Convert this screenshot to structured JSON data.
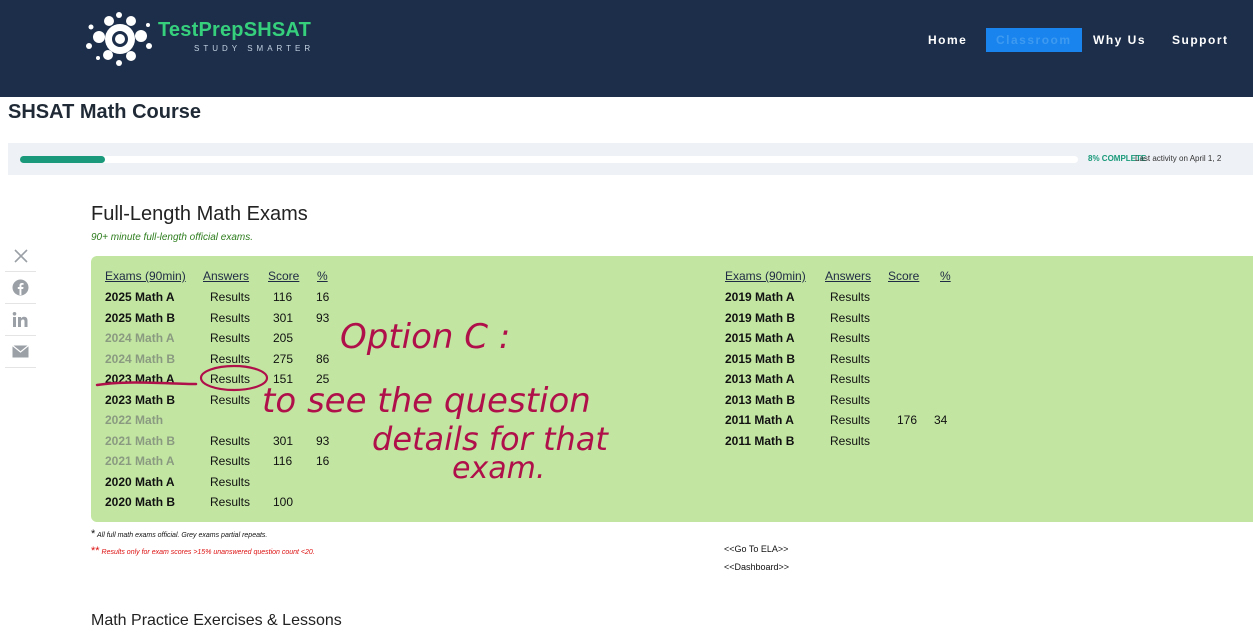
{
  "header": {
    "brand_name": "TestPrepSHSAT",
    "tagline": "STUDY SMARTER",
    "nav": {
      "home": "Home",
      "classroom": "Classroom",
      "why_us": "Why Us",
      "support": "Support"
    }
  },
  "page": {
    "title": "SHSAT Math Course"
  },
  "progress": {
    "percent": 8,
    "complete_label": "8% COMPLETE",
    "last_activity": "Last activity on April 1, 2"
  },
  "share": {
    "icons": [
      "x-icon",
      "facebook-icon",
      "linkedin-icon",
      "email-icon"
    ]
  },
  "exams": {
    "title": "Full-Length Math Exams",
    "subtitle": "90+ minute full-length official exams.",
    "headers": {
      "exam": "Exams (90min)",
      "answers": "Answers",
      "score": "Score",
      "pct": "%"
    },
    "left": [
      {
        "name": "2025 Math A",
        "answers": "Results",
        "score": "116",
        "pct": "16",
        "grey": false
      },
      {
        "name": "2025 Math B",
        "answers": "Results",
        "score": "301",
        "pct": "93",
        "grey": false
      },
      {
        "name": "2024 Math A",
        "answers": "Results",
        "score": "205",
        "pct": "",
        "grey": true
      },
      {
        "name": "2024 Math B",
        "answers": "Results",
        "score": "275",
        "pct": "86",
        "grey": true
      },
      {
        "name": "2023 Math A",
        "answers": "Results",
        "score": "151",
        "pct": "25",
        "grey": false
      },
      {
        "name": "2023 Math B",
        "answers": "Results",
        "score": "",
        "pct": "",
        "grey": false
      },
      {
        "name": "2022 Math",
        "answers": "",
        "score": "",
        "pct": "",
        "grey": true
      },
      {
        "name": "2021 Math B",
        "answers": "Results",
        "score": "301",
        "pct": "93",
        "grey": true
      },
      {
        "name": "2021 Math A",
        "answers": "Results",
        "score": "116",
        "pct": "16",
        "grey": true
      },
      {
        "name": "2020 Math A",
        "answers": "Results",
        "score": "",
        "pct": "",
        "grey": false
      },
      {
        "name": "2020 Math B",
        "answers": "Results",
        "score": "100",
        "pct": "",
        "grey": false
      }
    ],
    "right": [
      {
        "name": "2019 Math A",
        "answers": "Results",
        "score": "",
        "pct": ""
      },
      {
        "name": "2019 Math B",
        "answers": "Results",
        "score": "",
        "pct": ""
      },
      {
        "name": "2015 Math A",
        "answers": "Results",
        "score": "",
        "pct": ""
      },
      {
        "name": "2015 Math B",
        "answers": "Results",
        "score": "",
        "pct": ""
      },
      {
        "name": "2013 Math A",
        "answers": "Results",
        "score": "",
        "pct": ""
      },
      {
        "name": "2013 Math B",
        "answers": "Results",
        "score": "",
        "pct": ""
      },
      {
        "name": "2011 Math A",
        "answers": "Results",
        "score": "176",
        "pct": "34"
      },
      {
        "name": "2011 Math B",
        "answers": "Results",
        "score": "",
        "pct": ""
      }
    ],
    "note1_star": "*",
    "note1": "All full math exams official. Grey exams partial repeats.",
    "note2_star": "**",
    "note2": "Results only for exam scores >15% unanswered question count <20."
  },
  "links": {
    "ela": "<<Go To ELA>>",
    "dashboard": "<<Dashboard>>"
  },
  "section2": {
    "title": "Math Practice Exercises & Lessons"
  },
  "annotation": {
    "line1": "Option C :",
    "line2": "to see the question",
    "line3": "details for that",
    "line4": "exam."
  },
  "colors": {
    "navbar": "#1c2e4a",
    "brand": "#36d07d",
    "accent": "#1a84ee",
    "exam_bg": "#c2e6a2",
    "progress": "#1a9a7a",
    "ink": "#b0104a"
  }
}
